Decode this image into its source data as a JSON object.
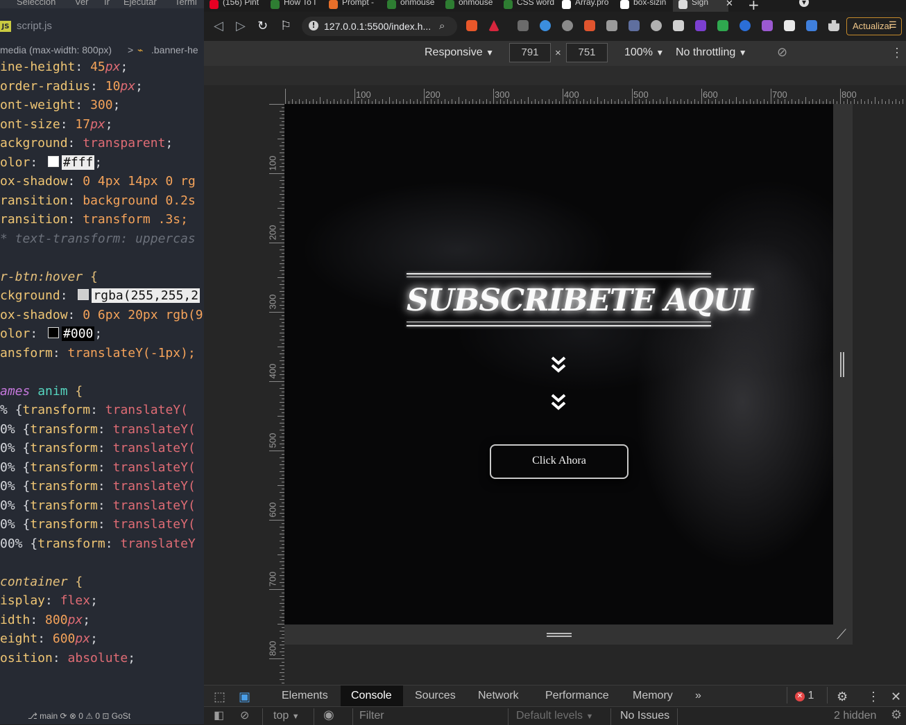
{
  "editor": {
    "menu": [
      "Selección",
      "Ver",
      "Ir",
      "Ejecutar",
      "Termi"
    ],
    "file_tab": "script.js",
    "file_icon": "JS",
    "breadcrumb": {
      "media": "media (max-width: 800px)",
      "sep": ">",
      "selector": ".banner-he"
    },
    "code_lines": [
      {
        "p": "ine-height",
        "v": "45",
        "u": "px",
        "e": ";"
      },
      {
        "p": "order-radius",
        "v": "10",
        "u": "px",
        "e": ";"
      },
      {
        "p": "ont-weight",
        "v": "300",
        "e": ";"
      },
      {
        "p": "ont-size",
        "v": "17",
        "u": "px",
        "e": ";"
      },
      {
        "p": "ackground",
        "k": "transparent",
        "e": ";"
      },
      {
        "p": "olor",
        "chip": "#fff",
        "e": ";"
      },
      {
        "p": "ox-shadow",
        "rest": "0 4px 14px 0 rg"
      },
      {
        "p": "ransition",
        "rest": "background 0.2s"
      },
      {
        "p": "ransition",
        "rest": "transform .3s;"
      },
      {
        "comment": "* text-transform: uppercas"
      },
      {
        "blank": ""
      },
      {
        "sel": "r-btn:hover",
        "brace": " {"
      },
      {
        "p": "ckground",
        "chip": "rgba(255,255,2"
      },
      {
        "p": "ox-shadow",
        "rest": "0 6px 20px rgb(9"
      },
      {
        "p": "olor",
        "chipd": "#000",
        "e": ";"
      },
      {
        "p": "ansform",
        "rest": "translateY(-1px);"
      },
      {
        "blank": ""
      },
      {
        "at": "ames",
        "name": " anim",
        "brace": " {"
      },
      {
        "kf": "%  {transform: translateY("
      },
      {
        "kf": "0% {transform: translateY("
      },
      {
        "kf": "0% {transform: translateY("
      },
      {
        "kf": "0% {transform: translateY("
      },
      {
        "kf": "0% {transform: translateY("
      },
      {
        "kf": "0% {transform: translateY("
      },
      {
        "kf": "0% {transform: translateY("
      },
      {
        "kf": "00% {transform: translateY"
      },
      {
        "blank": ""
      },
      {
        "sel": "container",
        "brace": " {"
      },
      {
        "p": "isplay",
        "k": "flex",
        "e": ";"
      },
      {
        "p": "idth",
        "v": "800",
        "u": "px",
        "e": ";"
      },
      {
        "p": "eight",
        "v": "600",
        "u": "px",
        "e": ";"
      },
      {
        "p": "osition",
        "k": "absolute",
        "e": ";"
      }
    ],
    "status": "⎇ main   ⟳   ⊗ 0 ⚠ 0   ⊡ GoSt"
  },
  "browser": {
    "tabs": [
      {
        "label": "(156) Pint",
        "color": "#e60023"
      },
      {
        "label": "How To I",
        "color": "#2e7d32"
      },
      {
        "label": "Prompt -",
        "color": "#e76f2a"
      },
      {
        "label": "onmouse",
        "color": "#2e7d32"
      },
      {
        "label": "onmouse",
        "color": "#2e7d32"
      },
      {
        "label": "CSS word",
        "color": "#2e7d32"
      },
      {
        "label": "Array.pro",
        "color": "#ffffff"
      },
      {
        "label": "box-sizin",
        "color": "#ffffff"
      },
      {
        "label": "Sign",
        "color": "#dddddd"
      }
    ],
    "url": "127.0.0.1:5500/index.h...",
    "update_label": "Actualizar"
  },
  "device_toolbar": {
    "mode": "Responsive",
    "width": "791",
    "height": "751",
    "zoom": "100%",
    "throttling": "No throttling"
  },
  "rulers": {
    "h": [
      "100",
      "200",
      "300",
      "400",
      "500",
      "600",
      "700",
      "800"
    ],
    "v": [
      "100",
      "200",
      "300",
      "400",
      "500",
      "600",
      "700",
      "800"
    ]
  },
  "page": {
    "title": "SUBSCRIBETE AQUI",
    "button": "Click Ahora"
  },
  "devtools": {
    "tabs": [
      "Elements",
      "Console",
      "Sources",
      "Network",
      "Performance",
      "Memory"
    ],
    "active_tab": "Console",
    "error_count": "1",
    "context": "top",
    "filter_placeholder": "Filter",
    "levels": "Default levels",
    "issues": "No Issues",
    "hidden": "2 hidden"
  },
  "colors": {
    "editor_bg": "#262a33",
    "devtools_bg": "#292929",
    "page_bg": "#070708",
    "update_border": "#c58a2b"
  }
}
